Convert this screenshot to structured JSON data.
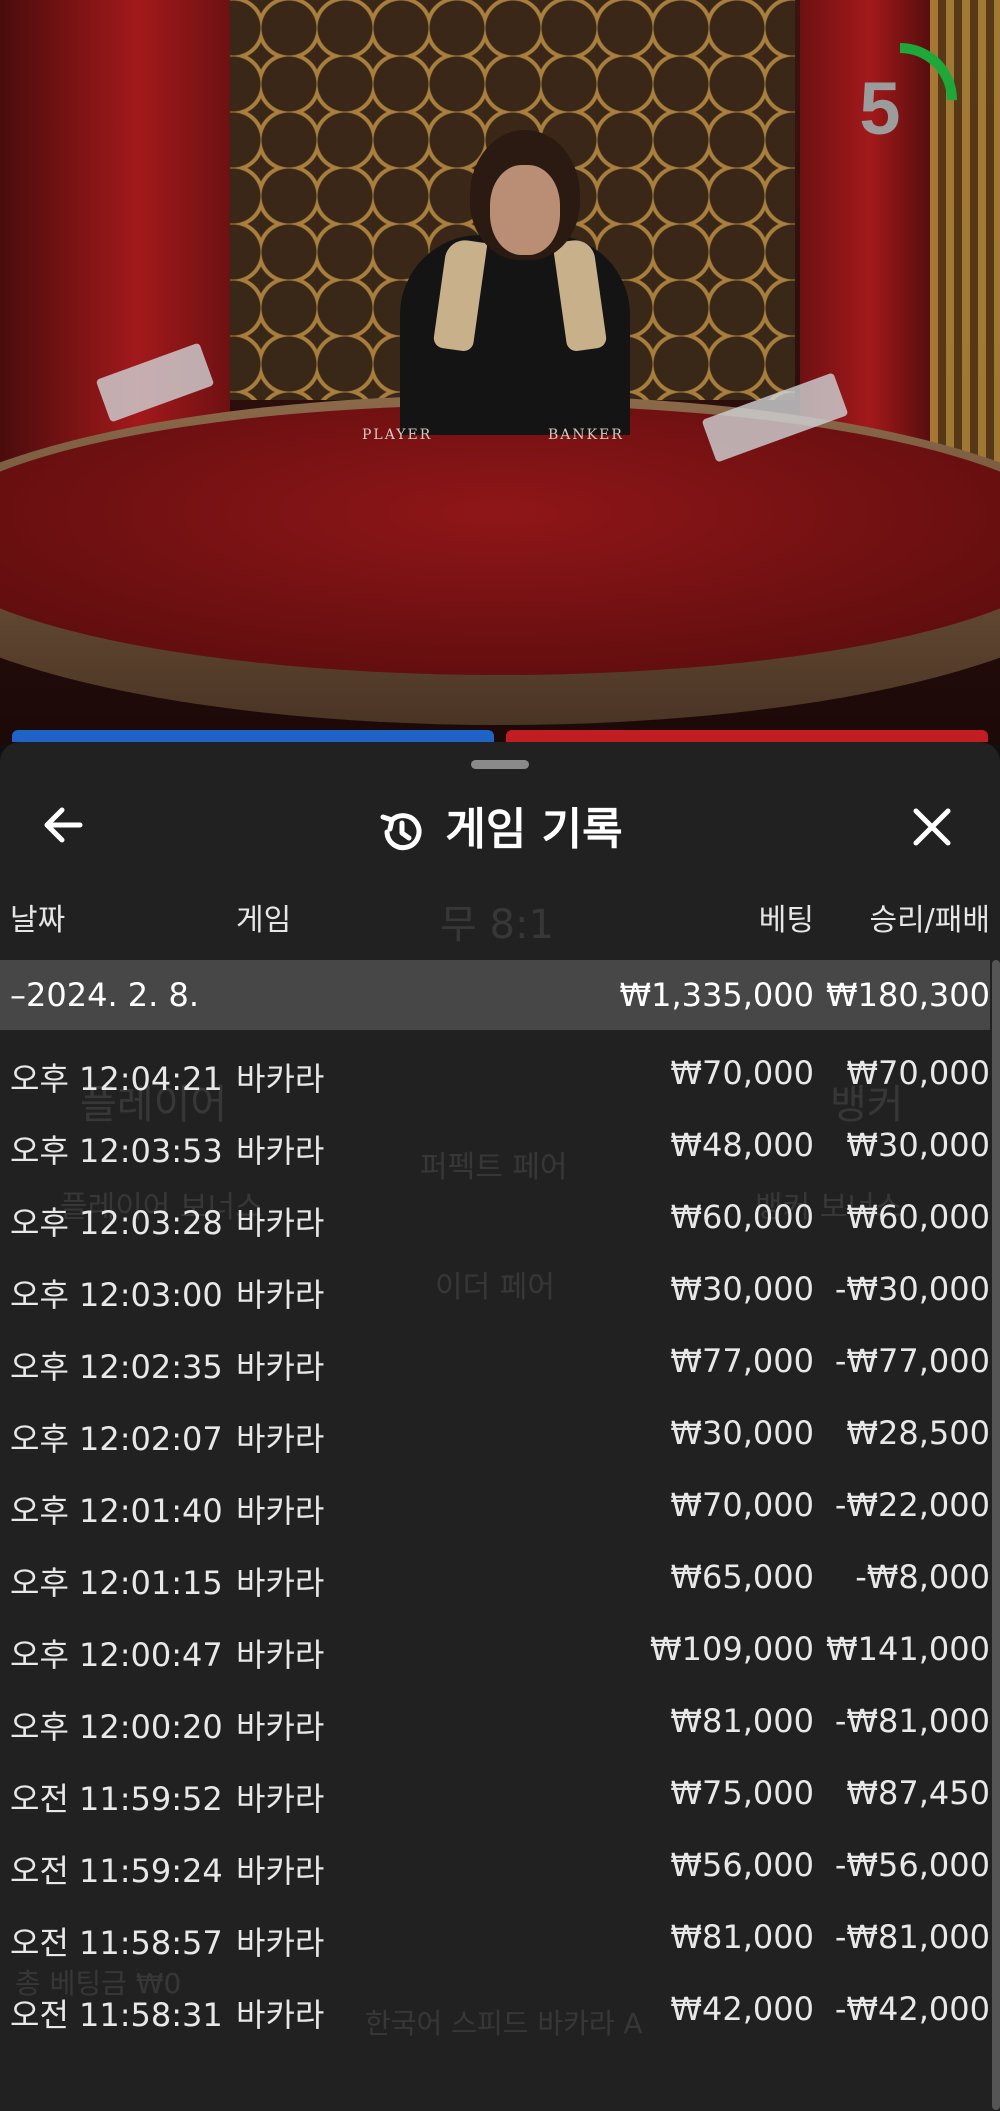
{
  "video": {
    "table_labels": {
      "player": "PLAYER",
      "banker": "BANKER"
    },
    "countdown": "5",
    "countdown_progress": 0.25,
    "accent_color": "#1fa83a"
  },
  "panel": {
    "title": "게임 기록",
    "back_icon": "arrow-left-icon",
    "close_icon": "close-icon",
    "history_icon": "history-icon",
    "columns": {
      "date": "날짜",
      "game": "게임",
      "bet": "베팅",
      "result": "승리/패배"
    },
    "summary": {
      "date": "–2024. 2. 8.",
      "bet": "₩1,335,000",
      "result": "₩180,300"
    },
    "rows": [
      {
        "time": "오후 12:04:21",
        "game": "바카라",
        "bet": "₩70,000",
        "result": "₩70,000"
      },
      {
        "time": "오후 12:03:53",
        "game": "바카라",
        "bet": "₩48,000",
        "result": "₩30,000"
      },
      {
        "time": "오후 12:03:28",
        "game": "바카라",
        "bet": "₩60,000",
        "result": "₩60,000"
      },
      {
        "time": "오후 12:03:00",
        "game": "바카라",
        "bet": "₩30,000",
        "result": "-₩30,000"
      },
      {
        "time": "오후 12:02:35",
        "game": "바카라",
        "bet": "₩77,000",
        "result": "-₩77,000"
      },
      {
        "time": "오후 12:02:07",
        "game": "바카라",
        "bet": "₩30,000",
        "result": "₩28,500"
      },
      {
        "time": "오후 12:01:40",
        "game": "바카라",
        "bet": "₩70,000",
        "result": "-₩22,000"
      },
      {
        "time": "오후 12:01:15",
        "game": "바카라",
        "bet": "₩65,000",
        "result": "-₩8,000"
      },
      {
        "time": "오후 12:00:47",
        "game": "바카라",
        "bet": "₩109,000",
        "result": "₩141,000"
      },
      {
        "time": "오후 12:00:20",
        "game": "바카라",
        "bet": "₩81,000",
        "result": "-₩81,000"
      },
      {
        "time": "오전 11:59:52",
        "game": "바카라",
        "bet": "₩75,000",
        "result": "₩87,450"
      },
      {
        "time": "오전 11:59:24",
        "game": "바카라",
        "bet": "₩56,000",
        "result": "-₩56,000"
      },
      {
        "time": "오전 11:58:57",
        "game": "바카라",
        "bet": "₩81,000",
        "result": "-₩81,000"
      },
      {
        "time": "오전 11:58:31",
        "game": "바카라",
        "bet": "₩42,000",
        "result": "-₩42,000"
      }
    ]
  },
  "background_ui": {
    "tie": "무 8:1",
    "player": "플레이어",
    "banker": "뱅커",
    "perfect_pair": "퍼펙트 페어",
    "player_bonus": "플레이어 보너스",
    "banker_bonus": "뱅커 보너스",
    "either_pair": "이더 페어",
    "total_bet": "총 베팅금 ₩0",
    "table_name": "한국어 스피드 바카라 A"
  }
}
